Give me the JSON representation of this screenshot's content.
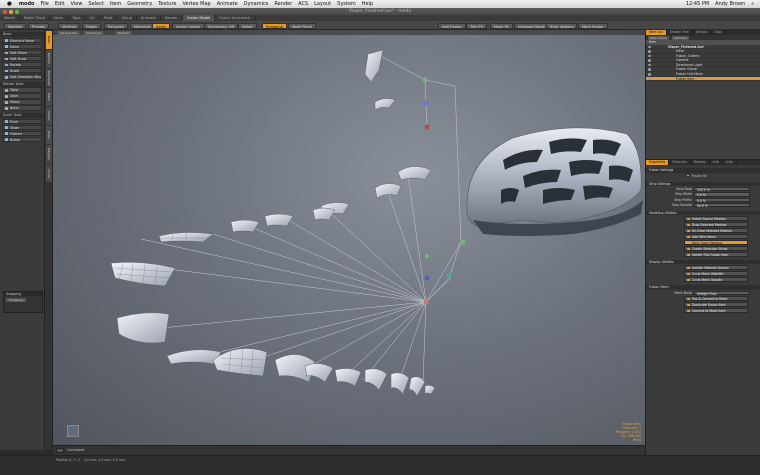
{
  "menubar": {
    "apple": "",
    "app": "modo",
    "items": [
      "File",
      "Edit",
      "View",
      "Select",
      "Item",
      "Geometry",
      "Texture",
      "Vertex Map",
      "Animate",
      "Dynamics",
      "Render",
      "ACS",
      "Layout",
      "System",
      "Help"
    ],
    "clock": "12:45 PM",
    "user": "Andy Brown"
  },
  "window": {
    "title": "Visper_Finished.lxo* - modo"
  },
  "tabs": [
    "Model",
    "Model Fixed",
    "Verts",
    "Topo",
    "UV",
    "Paint",
    "Setup",
    "Animate",
    "Render",
    "Fusion Model",
    "Fusion Schematic"
  ],
  "active_tab": 9,
  "toolbar": {
    "buttons": [
      "Modeler",
      "Presets",
      "Vertices",
      "Edges",
      "Polygons",
      "Materials",
      "Items",
      "Action Center",
      "Symmetry: Off",
      "Falloff",
      "Snapping",
      "Work Plane"
    ],
    "right_buttons": [
      "Add Fusion",
      "Trim Fit",
      "Mesh Fit",
      "Viewport Mode",
      "Strip Options",
      "Mark Fusion"
    ]
  },
  "left_panel": {
    "section1": "Basic",
    "tools1": [
      "Element Move",
      "Move",
      "Soft Move",
      "Soft Drag",
      "Rotate",
      "Scale",
      "Soft Selection Move"
    ],
    "section2": "Rotate Tools",
    "tools2": [
      "Twist",
      "Swirl",
      "Shear",
      "Bend"
    ],
    "section3": "Scale Tools",
    "tools3": [
      "Push",
      "Taper",
      "Flatten",
      "Bulge"
    ],
    "vtabs": [
      "Basic",
      "Deform",
      "Duplicate",
      "Mesh Edit",
      "Vertex",
      "Edge",
      "Polygon",
      "Curve"
    ],
    "snapping_header": "Snapping",
    "snapping_button": "Snapping"
  },
  "viewport": {
    "buttons": [
      "Perspective",
      "Advanced",
      "Default"
    ],
    "info": [
      "Fusion Item",
      "Channels: 3",
      "Polygons: 1,347",
      "GL: 386,000",
      "Paint"
    ]
  },
  "command": {
    "label": "Command"
  },
  "status": [
    "Position X, Y, Z",
    "0.0 mm, 0.0 mm, 0.0 mm"
  ],
  "right_panel": {
    "tabs": [
      "Item List",
      "Shader Tree",
      "Groups",
      "Clips"
    ],
    "filter": "Filter Items",
    "add_item": "Add Item",
    "header": "Item",
    "items": [
      {
        "label": "Visper_Finished.lxo*",
        "sel": false
      },
      {
        "label": "Mesh",
        "sel": false
      },
      {
        "label": "Fusion_Cutters",
        "sel": false
      },
      {
        "label": "Camera",
        "sel": false
      },
      {
        "label": "Directional Light",
        "sel": false
      },
      {
        "label": "Fusion Group",
        "sel": false
      },
      {
        "label": "Fusion Hull Mesh",
        "sel": false
      },
      {
        "label": "Fusion Item",
        "sel": true
      }
    ],
    "prop_tabs": [
      "Properties",
      "Channels",
      "Display",
      "Info",
      "Lists"
    ],
    "fusion_settings": "Fusion Settings",
    "fusion_on": "Fusion On",
    "strip_settings": "Strip Settings",
    "props": [
      {
        "label": "Strip Base",
        "value": "100.0 %"
      },
      {
        "label": "Strip Width",
        "value": "4.0 %"
      },
      {
        "label": "Strip Profile",
        "value": "0.0 %"
      },
      {
        "label": "Strip Smooth",
        "value": "50.0 %"
      }
    ],
    "modeling_utilities": "Modeling Utilities",
    "mod_buttons": [
      "Select Source Meshes",
      "Drop Selected Meshes",
      "Un-Drop Selected Meshes",
      "Add Strip Items",
      "Strip Clear Housing",
      "Create Selection Strips",
      "Delete This Fusion Item"
    ],
    "display_utilities": "Display Utilities",
    "disp_buttons": [
      "Update Material Groups",
      "Cycle Mesh Visibility",
      "Cycle Mesh Opacity"
    ],
    "fusion_mesh": "Fusion Mesh",
    "mesh_mode_label": "Mesh Mode",
    "mesh_mode_value": "Airtight Final",
    "mesh_buttons": [
      "Pop & Convert to Mesh",
      "Duplicate Fusion Item",
      "Convert to Mesh Item"
    ]
  },
  "colors": {
    "accent": "#e49a2a",
    "panel": "#3a3a3a",
    "viewport": "#6d737d"
  },
  "scene": {
    "count_fragments": 17
  }
}
